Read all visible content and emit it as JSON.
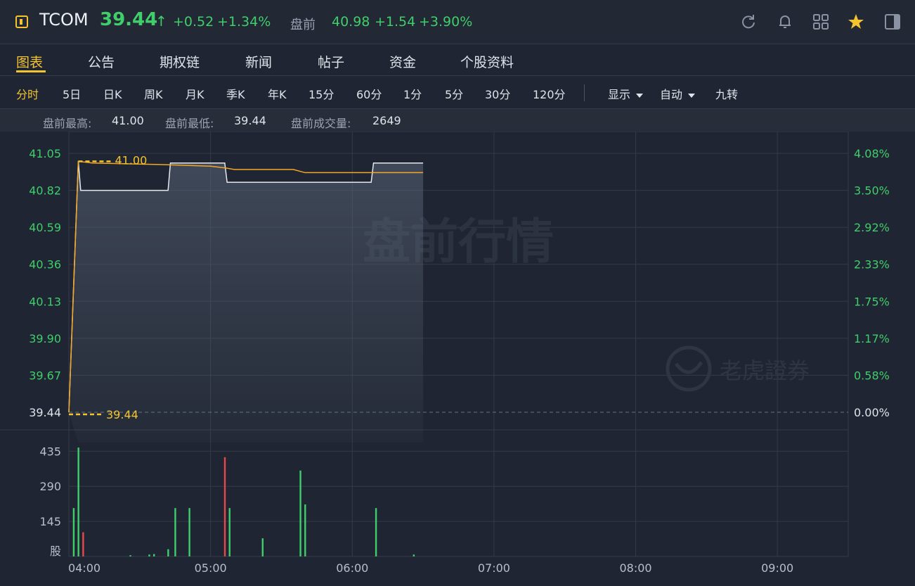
{
  "header": {
    "symbol": "TCOM",
    "price": "39.44",
    "price_arrow": "↑",
    "change": "+0.52",
    "change_pct": "+1.34%",
    "premarket_label": "盘前",
    "premarket_price": "40.98",
    "premarket_change": "+1.54",
    "premarket_change_pct": "+3.90%",
    "icons": [
      "refresh-icon",
      "bell-icon",
      "grid-icon",
      "star-icon",
      "panel-toggle-icon"
    ],
    "up_color": "#3fce6a",
    "accent_color": "#f4c430"
  },
  "tabs": {
    "chart": "图表",
    "announcements": "公告",
    "options": "期权链",
    "news": "新闻",
    "posts": "帖子",
    "funds": "资金",
    "profile": "个股资料"
  },
  "periods": {
    "intraday": "分时",
    "five_day": "5日",
    "daily": "日K",
    "weekly": "周K",
    "monthly": "月K",
    "quarterly": "季K",
    "yearly": "年K",
    "m15": "15分",
    "m60": "60分",
    "m1": "1分",
    "m5": "5分",
    "m30": "30分",
    "m120": "120分",
    "display": "显示",
    "auto": "自动",
    "nine_turn": "九转"
  },
  "stats": {
    "high_label": "盘前最高:",
    "high_value": "41.00",
    "low_label": "盘前最低:",
    "low_value": "39.44",
    "volume_label": "盘前成交量:",
    "volume_value": "2649"
  },
  "watermark": "盘前行情",
  "brand": "老虎證券",
  "chart_data": {
    "type": "line",
    "y_ticks": [
      "41.05",
      "40.82",
      "40.59",
      "40.36",
      "40.13",
      "39.90",
      "39.67",
      "39.44"
    ],
    "pct_ticks": [
      "4.08%",
      "3.50%",
      "2.92%",
      "2.33%",
      "1.75%",
      "1.17%",
      "0.58%",
      "0.00%"
    ],
    "ylim": [
      39.44,
      41.05
    ],
    "x_ticks": [
      "04:00",
      "05:00",
      "06:00",
      "07:00",
      "08:00",
      "09:00"
    ],
    "high_marker": "41.00",
    "low_marker": "39.44",
    "price_series": {
      "x_minutes": [
        0,
        4,
        5,
        42,
        43,
        66,
        67,
        128,
        129,
        150
      ],
      "values": [
        39.44,
        41.0,
        40.82,
        40.82,
        40.99,
        40.99,
        40.87,
        40.87,
        40.99,
        40.99
      ]
    },
    "avg_series": {
      "x_minutes": [
        0,
        4,
        10,
        40,
        60,
        66,
        70,
        95,
        100,
        130,
        150
      ],
      "values": [
        39.44,
        41.0,
        40.99,
        40.98,
        40.97,
        40.96,
        40.95,
        40.95,
        40.93,
        40.93,
        40.93
      ]
    },
    "volume": {
      "y_ticks": [
        "435",
        "290",
        "145"
      ],
      "unit_label": "股",
      "ymax": 500,
      "bars": [
        {
          "x": 2,
          "v": 200,
          "dir": "up"
        },
        {
          "x": 4,
          "v": 450,
          "dir": "up"
        },
        {
          "x": 6,
          "v": 100,
          "dir": "down"
        },
        {
          "x": 26,
          "v": 5,
          "dir": "up"
        },
        {
          "x": 34,
          "v": 8,
          "dir": "up"
        },
        {
          "x": 36,
          "v": 10,
          "dir": "up"
        },
        {
          "x": 42,
          "v": 30,
          "dir": "up"
        },
        {
          "x": 45,
          "v": 200,
          "dir": "up"
        },
        {
          "x": 51,
          "v": 200,
          "dir": "up"
        },
        {
          "x": 66,
          "v": 410,
          "dir": "down"
        },
        {
          "x": 68,
          "v": 200,
          "dir": "up"
        },
        {
          "x": 82,
          "v": 75,
          "dir": "up"
        },
        {
          "x": 98,
          "v": 355,
          "dir": "up"
        },
        {
          "x": 100,
          "v": 215,
          "dir": "up"
        },
        {
          "x": 130,
          "v": 200,
          "dir": "up"
        },
        {
          "x": 146,
          "v": 8,
          "dir": "up"
        }
      ]
    }
  }
}
